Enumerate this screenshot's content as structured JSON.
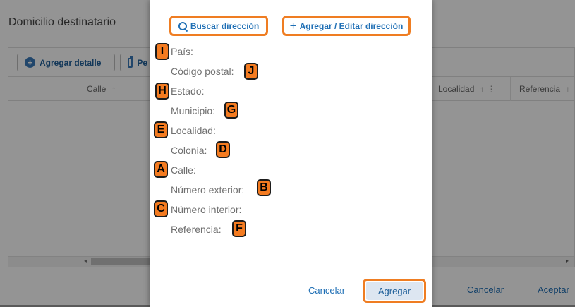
{
  "background": {
    "title": "Domicilio destinatario",
    "toolbar": {
      "add_detail_label": "Agregar detalle",
      "paste_label": "Pe"
    },
    "columns": [
      {
        "label": "Calle",
        "sort": "↑",
        "menu": ""
      },
      {
        "label": "Localidad",
        "sort": "↑",
        "menu": "⋮"
      },
      {
        "label": "Referencia",
        "sort": "↑",
        "menu": ""
      }
    ],
    "footer": {
      "cancel_label": "Cancelar",
      "accept_label": "Aceptar"
    }
  },
  "dialog": {
    "search_label": "Buscar dirección",
    "add_edit_label": "Agregar / Editar dirección",
    "fields": {
      "pais": "País:",
      "codigo_postal": "Código postal:",
      "estado": "Estado:",
      "municipio": "Municipio:",
      "localidad": "Localidad:",
      "colonia": "Colonia:",
      "calle": "Calle:",
      "numero_exterior": "Número exterior:",
      "numero_interior": "Número interior:",
      "referencia": "Referencia:"
    },
    "cancel_label": "Cancelar",
    "add_label": "Agregar"
  },
  "markers": {
    "pais": "I",
    "codigo_postal": "J",
    "estado": "H",
    "municipio": "G",
    "localidad": "E",
    "colonia": "D",
    "calle": "A",
    "numero_exterior": "B",
    "numero_interior": "C",
    "referencia": "F"
  },
  "colors": {
    "accent": "#1f6fb5",
    "highlight": "#ef7d22",
    "marker": "#f47b20"
  }
}
